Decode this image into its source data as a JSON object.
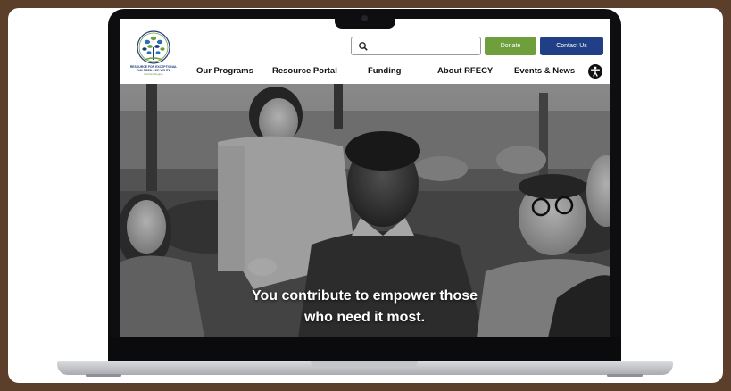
{
  "header": {
    "logo": {
      "line1": "RESOURCE FOR EXCEPTIONAL",
      "line2": "CHILDREN AND YOUTH",
      "line3": "Durham Region"
    },
    "search": {
      "placeholder": "",
      "icon": "search-icon"
    },
    "donate_label": "Donate",
    "contact_label": "Contact Us",
    "nav": [
      "Our Programs",
      "Resource Portal",
      "Funding",
      "About RFECY",
      "Events & News"
    ],
    "accessibility_icon": "accessibility-icon"
  },
  "hero": {
    "line1": "You contribute to empower those",
    "line2": "who need it most."
  },
  "colors": {
    "donate": "#6f9e3d",
    "contact": "#213f87",
    "frame": "#5b3f2a"
  }
}
